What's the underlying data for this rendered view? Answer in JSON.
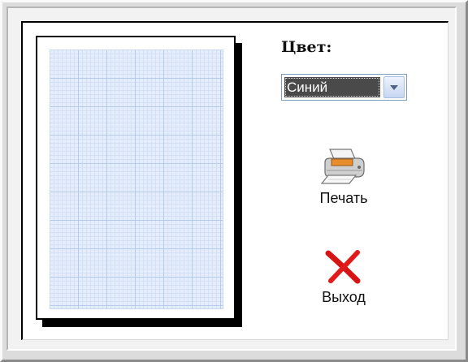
{
  "color_section": {
    "label": "Цвет:",
    "selected": "Синий"
  },
  "actions": {
    "print_label": "Печать",
    "exit_label": "Выход"
  },
  "icons": {
    "print": "printer-icon",
    "exit": "red-x-icon",
    "dropdown": "chevron-down-icon"
  },
  "colors": {
    "grid_fill": "#e4edfb",
    "grid_lines": "#b8cbeb",
    "select_highlight": "#4a4a4a",
    "exit_icon": "#dd1111"
  }
}
